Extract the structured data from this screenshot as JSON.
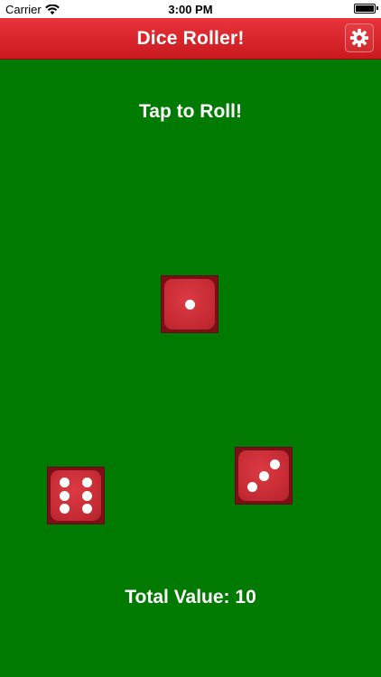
{
  "status_bar": {
    "carrier": "Carrier",
    "time": "3:00 PM",
    "wifi_icon": "wifi-icon",
    "battery_icon": "battery-icon"
  },
  "nav_bar": {
    "title": "Dice Roller!",
    "settings_icon": "gear-icon",
    "color_top": "#e8343a",
    "color_bottom": "#c9191f"
  },
  "main": {
    "prompt": "Tap to Roll!",
    "total": "Total Value: 10",
    "background_color": "#007a00",
    "die_color": "#c42a33",
    "dice": [
      {
        "value": 1
      },
      {
        "value": 6
      },
      {
        "value": 3
      }
    ]
  }
}
